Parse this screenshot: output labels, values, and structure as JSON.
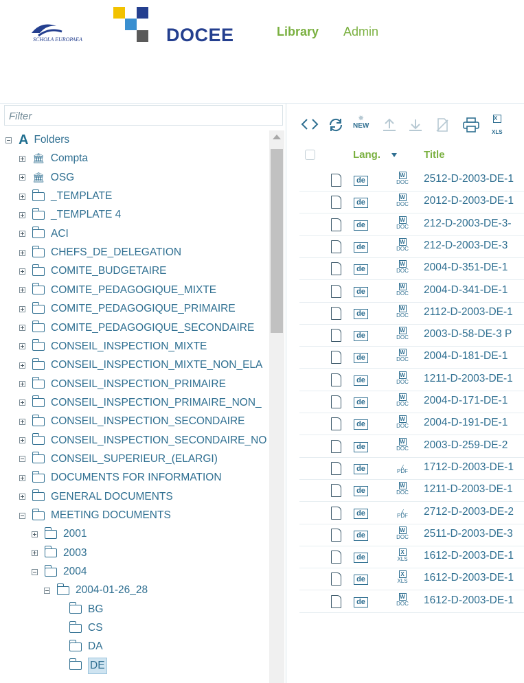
{
  "header": {
    "logo_left_text": "SCHOLA EUROPAEA",
    "brand": "DOCEE",
    "nav": [
      {
        "label": "Library"
      },
      {
        "label": "Admin"
      }
    ],
    "colors": {
      "accent_green": "#7ab040",
      "brand_blue": "#243f8f",
      "text_teal": "#2f6f91"
    }
  },
  "filter": {
    "placeholder": "Filter"
  },
  "tree": [
    {
      "label": "Folders",
      "icon": "a-logo-icon",
      "toggle": "minus",
      "level": 0
    },
    {
      "label": "Compta",
      "icon": "bank-icon",
      "toggle": "plus",
      "level": 1
    },
    {
      "label": "OSG",
      "icon": "bank-icon",
      "toggle": "plus",
      "level": 1
    },
    {
      "label": "_TEMPLATE",
      "icon": "folder-icon",
      "toggle": "plus",
      "level": 1
    },
    {
      "label": "_TEMPLATE 4",
      "icon": "folder-icon",
      "toggle": "plus",
      "level": 1
    },
    {
      "label": "ACI",
      "icon": "folder-icon",
      "toggle": "plus",
      "level": 1
    },
    {
      "label": "CHEFS_DE_DELEGATION",
      "icon": "folder-icon",
      "toggle": "plus",
      "level": 1
    },
    {
      "label": "COMITE_BUDGETAIRE",
      "icon": "folder-icon",
      "toggle": "plus",
      "level": 1
    },
    {
      "label": "COMITE_PEDAGOGIQUE_MIXTE",
      "icon": "folder-icon",
      "toggle": "plus",
      "level": 1
    },
    {
      "label": "COMITE_PEDAGOGIQUE_PRIMAIRE",
      "icon": "folder-icon",
      "toggle": "plus",
      "level": 1
    },
    {
      "label": "COMITE_PEDAGOGIQUE_SECONDAIRE",
      "icon": "folder-icon",
      "toggle": "plus",
      "level": 1
    },
    {
      "label": "CONSEIL_INSPECTION_MIXTE",
      "icon": "folder-icon",
      "toggle": "plus",
      "level": 1
    },
    {
      "label": "CONSEIL_INSPECTION_MIXTE_NON_ELA",
      "icon": "folder-icon",
      "toggle": "plus",
      "level": 1
    },
    {
      "label": "CONSEIL_INSPECTION_PRIMAIRE",
      "icon": "folder-icon",
      "toggle": "plus",
      "level": 1
    },
    {
      "label": "CONSEIL_INSPECTION_PRIMAIRE_NON_",
      "icon": "folder-icon",
      "toggle": "plus",
      "level": 1
    },
    {
      "label": "CONSEIL_INSPECTION_SECONDAIRE",
      "icon": "folder-icon",
      "toggle": "plus",
      "level": 1
    },
    {
      "label": "CONSEIL_INSPECTION_SECONDAIRE_NO",
      "icon": "folder-icon",
      "toggle": "plus",
      "level": 1
    },
    {
      "label": "CONSEIL_SUPERIEUR_(ELARGI)",
      "icon": "folder-icon",
      "toggle": "minus",
      "level": 1
    },
    {
      "label": "DOCUMENTS FOR INFORMATION",
      "icon": "folder-icon",
      "toggle": "plus",
      "level": 2
    },
    {
      "label": "GENERAL DOCUMENTS",
      "icon": "folder-icon",
      "toggle": "plus",
      "level": 2
    },
    {
      "label": "MEETING DOCUMENTS",
      "icon": "folder-icon",
      "toggle": "minus",
      "level": 2
    },
    {
      "label": "2001",
      "icon": "folder-icon",
      "toggle": "plus",
      "level": 3
    },
    {
      "label": "2003",
      "icon": "folder-icon",
      "toggle": "plus",
      "level": 3
    },
    {
      "label": "2004",
      "icon": "folder-icon",
      "toggle": "minus",
      "level": 3
    },
    {
      "label": "2004-01-26_28",
      "icon": "folder-icon",
      "toggle": "minus",
      "level": 4
    },
    {
      "label": "BG",
      "icon": "folder-icon",
      "toggle": "none",
      "level": 5
    },
    {
      "label": "CS",
      "icon": "folder-icon",
      "toggle": "none",
      "level": 5
    },
    {
      "label": "DA",
      "icon": "folder-icon",
      "toggle": "none",
      "level": 5
    },
    {
      "label": "DE",
      "icon": "folder-icon",
      "toggle": "none",
      "level": 5,
      "selected": true
    }
  ],
  "toolbar": {
    "icons": [
      "code-icon",
      "refresh-icon",
      "new-icon",
      "upload-icon",
      "download-icon",
      "unlink-icon",
      "print-icon",
      "xls-export-icon"
    ],
    "new_label": "NEW",
    "xls_label": "XLS"
  },
  "table": {
    "columns": {
      "lang": "Lang.",
      "title": "Title"
    },
    "rows": [
      {
        "lang": "de",
        "type": "DOC",
        "title": "2512-D-2003-DE-1"
      },
      {
        "lang": "de",
        "type": "DOC",
        "title": "2012-D-2003-DE-1"
      },
      {
        "lang": "de",
        "type": "DOC",
        "title": "212-D-2003-DE-3-"
      },
      {
        "lang": "de",
        "type": "DOC",
        "title": "212-D-2003-DE-3"
      },
      {
        "lang": "de",
        "type": "DOC",
        "title": "2004-D-351-DE-1"
      },
      {
        "lang": "de",
        "type": "DOC",
        "title": "2004-D-341-DE-1"
      },
      {
        "lang": "de",
        "type": "DOC",
        "title": "2112-D-2003-DE-1"
      },
      {
        "lang": "de",
        "type": "DOC",
        "title": "2003-D-58-DE-3 P"
      },
      {
        "lang": "de",
        "type": "DOC",
        "title": "2004-D-181-DE-1"
      },
      {
        "lang": "de",
        "type": "DOC",
        "title": "1211-D-2003-DE-1"
      },
      {
        "lang": "de",
        "type": "DOC",
        "title": "2004-D-171-DE-1"
      },
      {
        "lang": "de",
        "type": "DOC",
        "title": "2004-D-191-DE-1"
      },
      {
        "lang": "de",
        "type": "DOC",
        "title": "2003-D-259-DE-2"
      },
      {
        "lang": "de",
        "type": "PDF",
        "title": "1712-D-2003-DE-1"
      },
      {
        "lang": "de",
        "type": "DOC",
        "title": "1211-D-2003-DE-1"
      },
      {
        "lang": "de",
        "type": "PDF",
        "title": "2712-D-2003-DE-2"
      },
      {
        "lang": "de",
        "type": "DOC",
        "title": "2511-D-2003-DE-3"
      },
      {
        "lang": "de",
        "type": "XLS",
        "title": "1612-D-2003-DE-1"
      },
      {
        "lang": "de",
        "type": "XLS",
        "title": "1612-D-2003-DE-1"
      },
      {
        "lang": "de",
        "type": "DOC",
        "title": "1612-D-2003-DE-1"
      }
    ]
  }
}
